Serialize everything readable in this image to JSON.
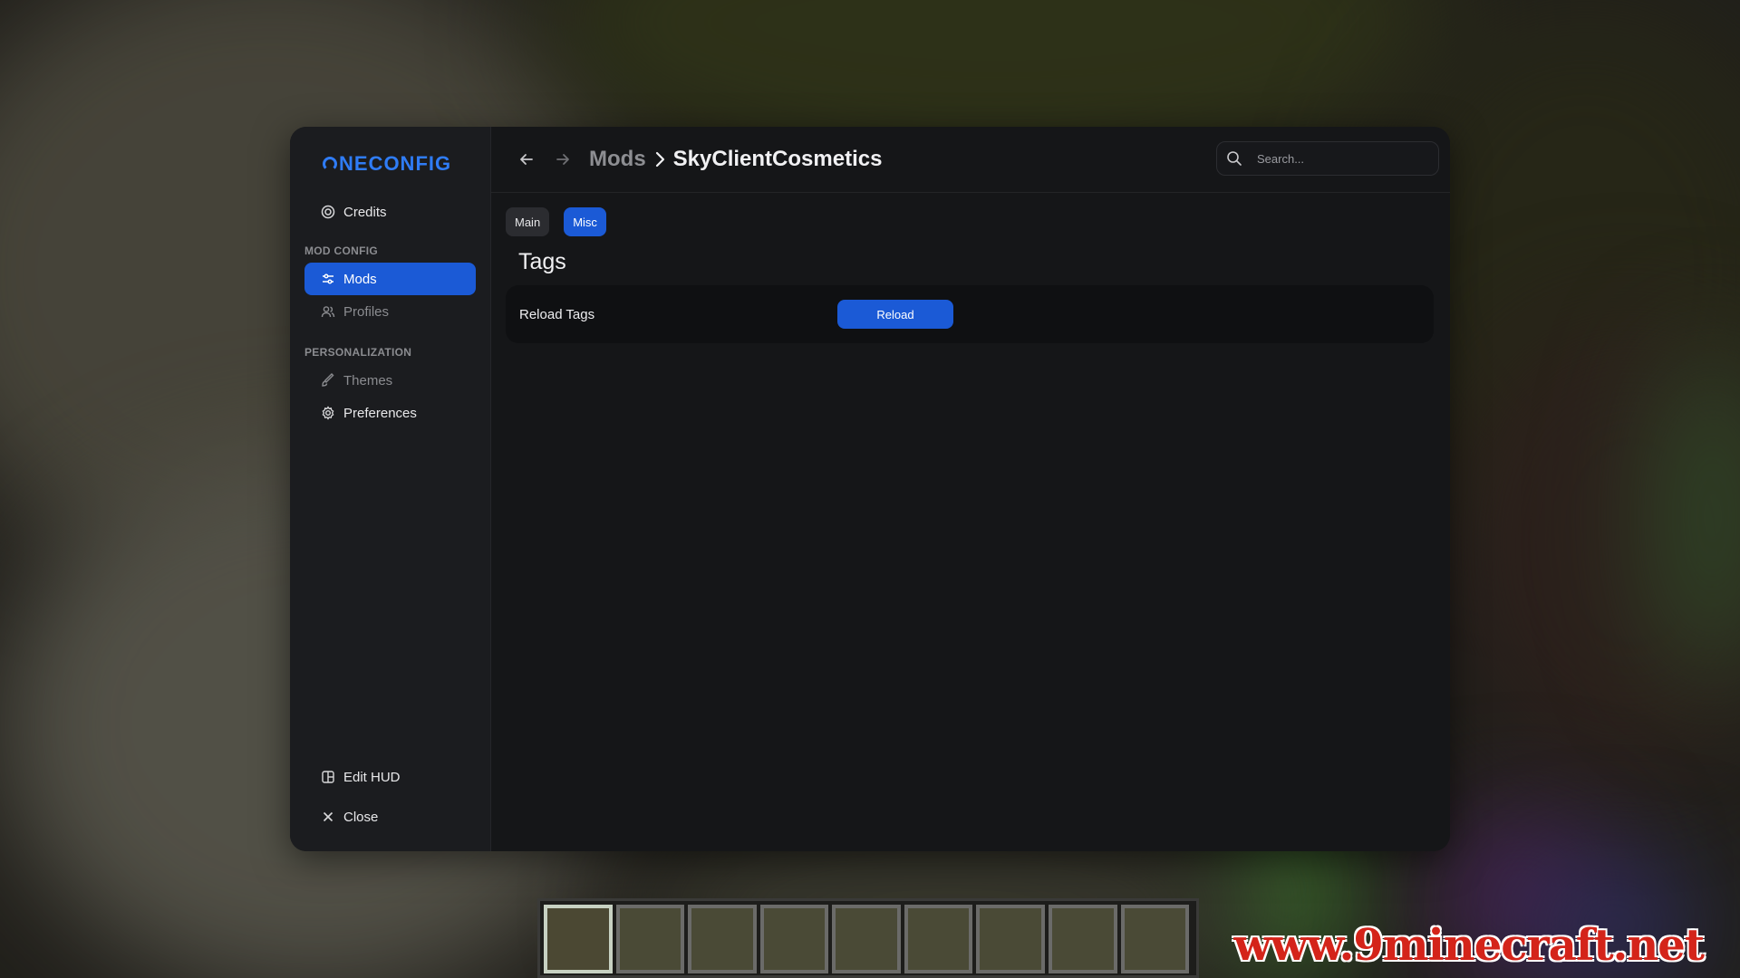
{
  "app": {
    "logo_text": "NECONFIG"
  },
  "sidebar": {
    "credits_label": "Credits",
    "section_mod_config": "MOD CONFIG",
    "mods_label": "Mods",
    "profiles_label": "Profiles",
    "section_personalization": "PERSONALIZATION",
    "themes_label": "Themes",
    "preferences_label": "Preferences",
    "edit_hud_label": "Edit HUD",
    "close_label": "Close"
  },
  "header": {
    "breadcrumb_parent": "Mods",
    "breadcrumb_current": "SkyClientCosmetics",
    "search_placeholder": "Search..."
  },
  "tabs": [
    {
      "label": "Main",
      "active": false
    },
    {
      "label": "Misc",
      "active": true
    }
  ],
  "content": {
    "section_title": "Tags",
    "option_label": "Reload Tags",
    "button_label": "Reload"
  },
  "hotbar": {
    "slot_count": 9,
    "selected_slot": 1
  },
  "watermark": "www.9minecraft.net",
  "colors": {
    "accent": "#1b5ad6",
    "logo": "#2f7cf6",
    "window_bg": "#151618",
    "sidebar_bg": "#1b1c1f"
  }
}
